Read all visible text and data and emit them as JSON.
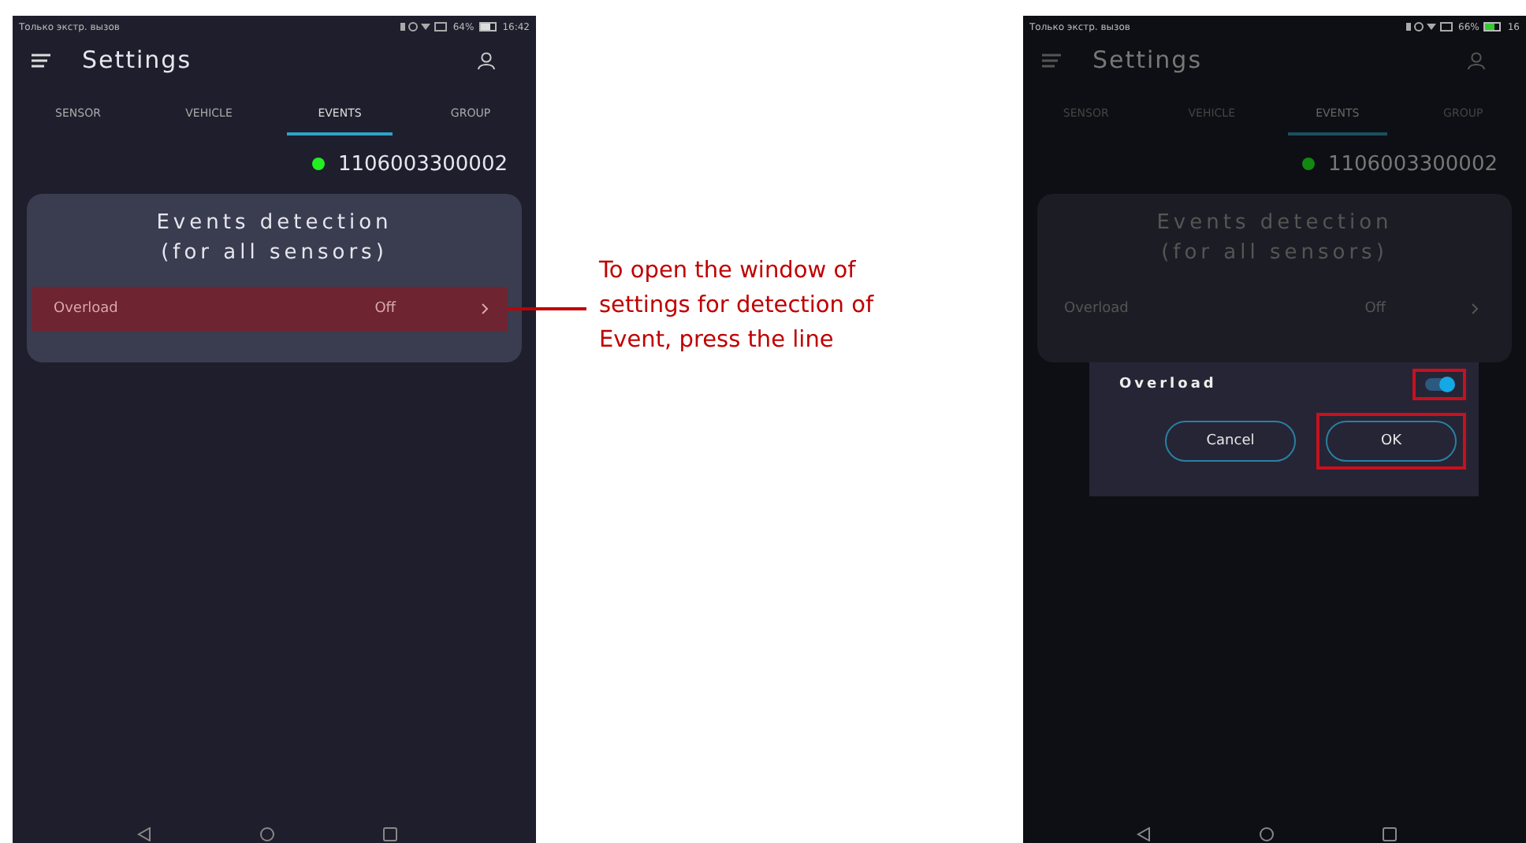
{
  "phones": [
    {
      "dimmed": false,
      "status_bar": {
        "carrier": "Только экстр. вызов",
        "battery": "64%",
        "time": "16:42"
      },
      "title": "Settings",
      "tabs": [
        {
          "label": "SENSOR",
          "selected": false
        },
        {
          "label": "VEHICLE",
          "selected": false
        },
        {
          "label": "EVENTS",
          "selected": true
        },
        {
          "label": "GROUP",
          "selected": false
        }
      ],
      "device": {
        "id": "1106003300002",
        "online": true
      },
      "card": {
        "title_lines": [
          "Events detection",
          "(for all sensors)"
        ],
        "rows": [
          {
            "label": "Overload",
            "value": "Off",
            "highlighted": true
          }
        ]
      }
    },
    {
      "dimmed": true,
      "status_bar": {
        "carrier": "Только экстр. вызов",
        "battery": "66%",
        "time": "16"
      },
      "title": "Settings",
      "tabs": [
        {
          "label": "SENSOR",
          "selected": false
        },
        {
          "label": "VEHICLE",
          "selected": false
        },
        {
          "label": "EVENTS",
          "selected": true
        },
        {
          "label": "GROUP",
          "selected": false
        }
      ],
      "device": {
        "id": "1106003300002",
        "online": true
      },
      "card": {
        "title_lines": [
          "Events detection",
          "(for all sensors)"
        ],
        "rows": [
          {
            "label": "Overload",
            "value": "Off",
            "highlighted": false
          }
        ]
      },
      "dialog": {
        "label": "Overload",
        "on": true,
        "highlighted": true,
        "buttons": [
          {
            "label": "Cancel",
            "highlighted": false
          },
          {
            "label": "OK",
            "highlighted": true
          }
        ]
      }
    }
  ],
  "callout": {
    "text": "To open the window of settings for detection of Event, press the line"
  }
}
